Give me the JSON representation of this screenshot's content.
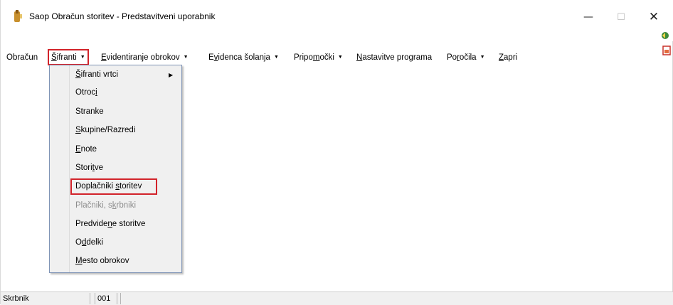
{
  "window": {
    "title": "Saop Obračun storitev - Predstavitveni uporabnik",
    "minimize_glyph": "—",
    "maximize_glyph": "☐",
    "close_glyph": "✕"
  },
  "menubar": {
    "items": [
      {
        "pre": "Obračun",
        "u": "",
        "post": "",
        "has_arrow": false
      },
      {
        "pre": "",
        "u": "Š",
        "post": "ifranti",
        "has_arrow": true
      },
      {
        "pre": "",
        "u": "E",
        "post": "videntiranje obrokov",
        "has_arrow": true
      },
      {
        "pre": "E",
        "u": "v",
        "post": "idenca šolanja",
        "has_arrow": true
      },
      {
        "pre": "Pripo",
        "u": "m",
        "post": "očki",
        "has_arrow": true
      },
      {
        "pre": "",
        "u": "N",
        "post": "astavitve programa",
        "has_arrow": false
      },
      {
        "pre": "Po",
        "u": "r",
        "post": "očila",
        "has_arrow": true
      },
      {
        "pre": "",
        "u": "Z",
        "post": "apri",
        "has_arrow": false
      }
    ],
    "arrow_glyph": "▼"
  },
  "dropdown": {
    "items": [
      {
        "pre": "",
        "u": "Š",
        "post": "ifranti vrtci",
        "disabled": false
      },
      {
        "pre": "Otroc",
        "u": "i",
        "post": "",
        "disabled": false
      },
      {
        "pre": "Stranke",
        "u": "",
        "post": "",
        "disabled": false
      },
      {
        "pre": "",
        "u": "S",
        "post": "kupine/Razredi",
        "disabled": false
      },
      {
        "pre": "",
        "u": "E",
        "post": "note",
        "disabled": false
      },
      {
        "pre": "Stori",
        "u": "t",
        "post": "ve",
        "disabled": false
      },
      {
        "pre": "Doplačniki ",
        "u": "s",
        "post": "toritev",
        "disabled": false
      },
      {
        "pre": "Plačniki, s",
        "u": "k",
        "post": "rbniki",
        "disabled": true
      },
      {
        "pre": "Predvide",
        "u": "n",
        "post": "e storitve",
        "disabled": false
      },
      {
        "pre": "O",
        "u": "d",
        "post": "delki",
        "disabled": false
      },
      {
        "pre": "",
        "u": "M",
        "post": "esto obrokov",
        "disabled": false
      }
    ],
    "submenu_arrow": "▶"
  },
  "statusbar": {
    "cell1": "Skrbnik",
    "cell2": "001",
    "cell3": ""
  },
  "colors": {
    "highlight_border": "#d2232a",
    "menu_background": "#f0f0f0",
    "disabled_text": "#8d8d8d"
  }
}
